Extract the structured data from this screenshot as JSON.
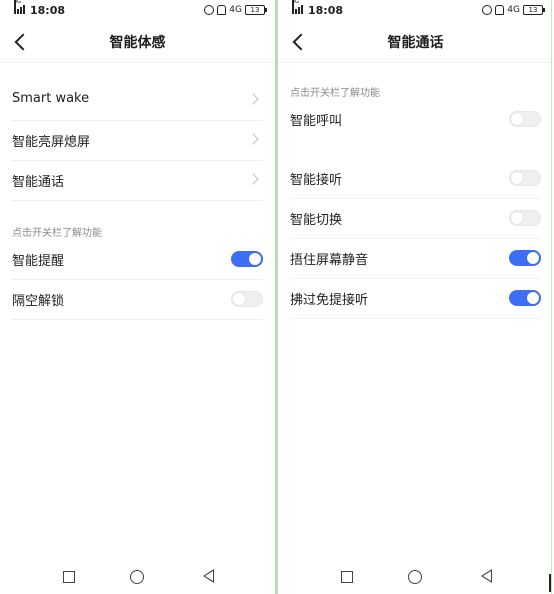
{
  "status": {
    "time": "18:08",
    "network": "4G",
    "battery": "13"
  },
  "left": {
    "title": "智能体感",
    "rows": [
      {
        "label": "Smart wake"
      },
      {
        "label": "智能亮屏熄屏"
      },
      {
        "label": "智能通话"
      }
    ],
    "section_hint": "点击开关栏了解功能",
    "toggles": [
      {
        "label": "智能提醒",
        "on": true
      },
      {
        "label": "隔空解锁",
        "on": false
      }
    ]
  },
  "right": {
    "title": "智能通话",
    "section_hint": "点击开关栏了解功能",
    "toggles": [
      {
        "label": "智能呼叫",
        "on": false
      },
      {
        "label": "智能接听",
        "on": false
      },
      {
        "label": "智能切换",
        "on": false
      },
      {
        "label": "捂住屏幕静音",
        "on": true
      },
      {
        "label": "拂过免提接听",
        "on": true
      }
    ]
  },
  "colors": {
    "toggle_on": "#3d6ef5",
    "toggle_off": "#efefef"
  },
  "icons": [
    "signal-icon",
    "alarm-icon",
    "mute-icon",
    "battery-icon",
    "back-arrow-icon",
    "recent-apps-icon",
    "home-icon",
    "nav-back-icon",
    "chevron-right-icon"
  ]
}
